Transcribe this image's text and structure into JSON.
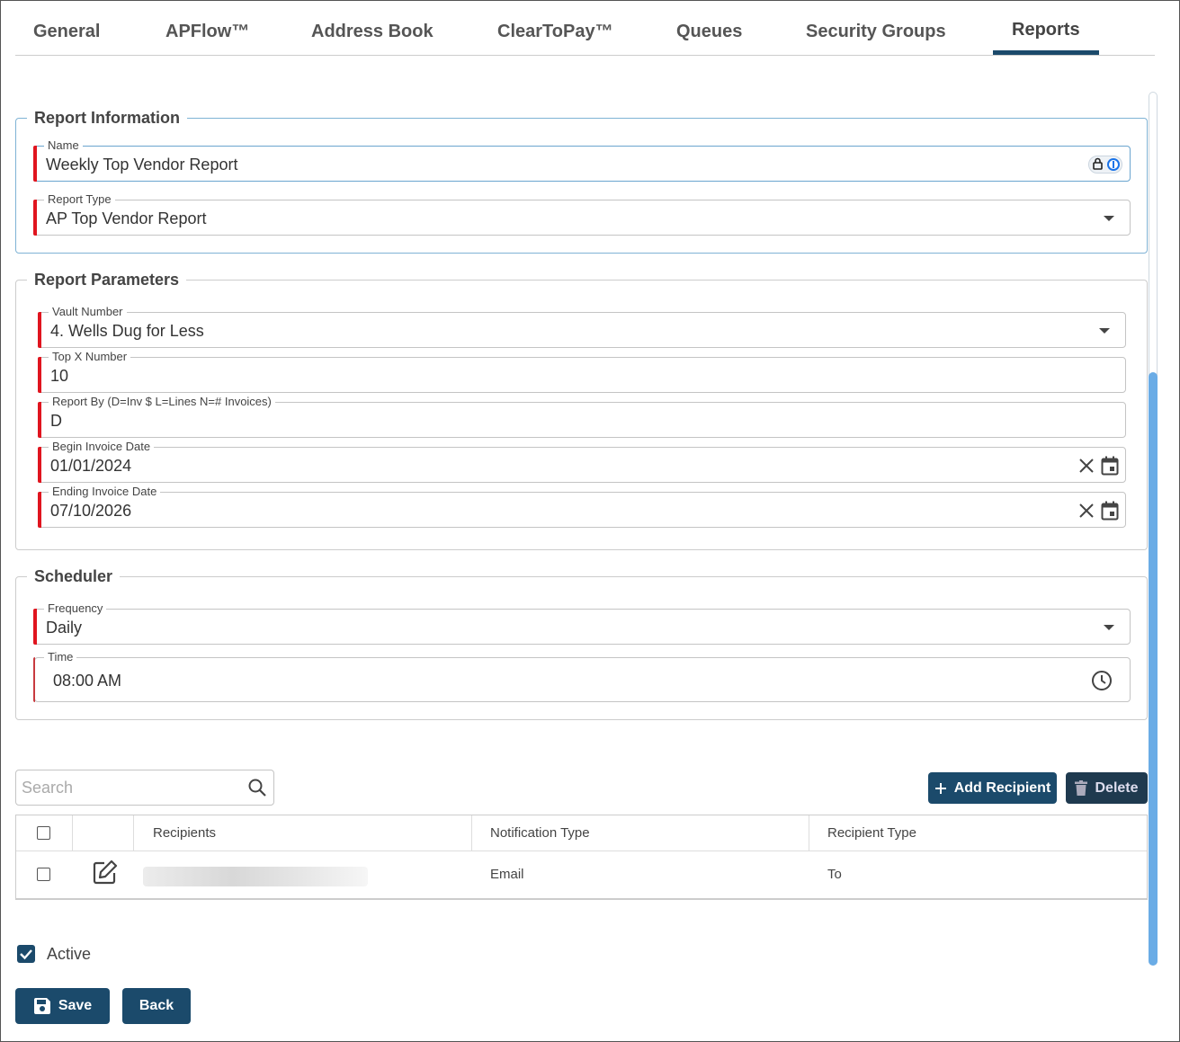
{
  "tabs": [
    {
      "label": "General"
    },
    {
      "label": "APFlow™"
    },
    {
      "label": "Address Book"
    },
    {
      "label": "ClearToPay™"
    },
    {
      "label": "Queues"
    },
    {
      "label": "Security Groups"
    },
    {
      "label": "Reports",
      "active": true
    }
  ],
  "report_information": {
    "legend": "Report Information",
    "name": {
      "label": "Name",
      "value": "Weekly Top Vendor Report"
    },
    "report_type": {
      "label": "Report Type",
      "value": "AP Top Vendor Report"
    }
  },
  "report_parameters": {
    "legend": "Report Parameters",
    "vault_number": {
      "label": "Vault Number",
      "value": "4. Wells Dug for Less"
    },
    "top_x": {
      "label": "Top X Number",
      "value": "10"
    },
    "report_by": {
      "label": "Report By (D=Inv $ L=Lines N=# Invoices)",
      "value": "D"
    },
    "begin_date": {
      "label": "Begin Invoice Date",
      "value": "01/01/2024"
    },
    "end_date": {
      "label": "Ending Invoice Date",
      "value": "07/10/2026"
    }
  },
  "scheduler": {
    "legend": "Scheduler",
    "frequency": {
      "label": "Frequency",
      "value": "Daily"
    },
    "time": {
      "label": "Time",
      "value": "08:00 AM"
    }
  },
  "recipients": {
    "search_placeholder": "Search",
    "add_label": "Add Recipient",
    "delete_label": "Delete",
    "columns": [
      "Recipients",
      "Notification Type",
      "Recipient Type"
    ],
    "rows": [
      {
        "notification_type": "Email",
        "recipient_type": "To"
      }
    ]
  },
  "active": {
    "label": "Active",
    "checked": true
  },
  "footer": {
    "save_label": "Save",
    "back_label": "Back"
  },
  "colors": {
    "primary": "#1b4a6b",
    "required": "#e0151f",
    "scroll": "#6aace6"
  }
}
